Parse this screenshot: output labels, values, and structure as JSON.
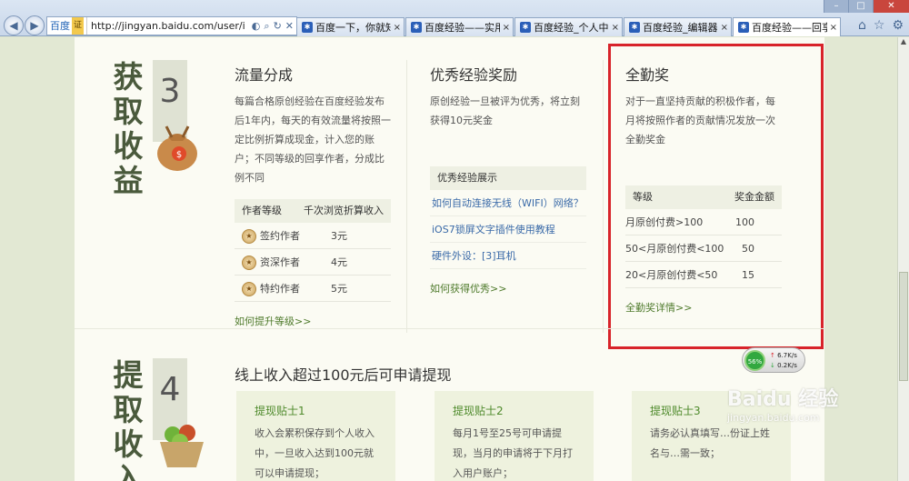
{
  "browser": {
    "address_brand": "百度",
    "address_brand_badge": "证",
    "url": "http://jingyan.baidu.com/user/i",
    "tabs": [
      {
        "label": "百度一下，你就知道",
        "active": false
      },
      {
        "label": "百度经验——实用生活...",
        "active": false
      },
      {
        "label": "百度经验_个人中心_我...",
        "active": false
      },
      {
        "label": "百度经验_编辑器",
        "active": false
      },
      {
        "label": "百度经验——回享计...",
        "active": true
      }
    ]
  },
  "section3": {
    "number": "3",
    "vertical_title": [
      "获",
      "取",
      "收",
      "益"
    ],
    "col1": {
      "title": "流量分成",
      "desc": "每篇合格原创经验在百度经验发布后1年内，每天的有效流量将按照一定比例折算成现金，计入您的账户；不同等级的回享作者，分成比例不同",
      "table_headers": [
        "作者等级",
        "千次浏览折算收入"
      ],
      "rows": [
        {
          "level": "签约作者",
          "income": "3元"
        },
        {
          "level": "资深作者",
          "income": "4元"
        },
        {
          "level": "特约作者",
          "income": "5元"
        }
      ],
      "link": "如何提升等级>>"
    },
    "col2": {
      "title": "优秀经验奖励",
      "desc": "原创经验一旦被评为优秀，将立刻获得10元奖金",
      "showcase_header": "优秀经验展示",
      "items": [
        "如何自动连接无线（WIFI）网络？",
        "iOS7锁屏文字插件使用教程",
        "硬件外设：[3]耳机"
      ],
      "link": "如何获得优秀>>"
    },
    "col3": {
      "title": "全勤奖",
      "desc": "对于一直坚持贡献的积极作者，每月将按照作者的贡献情况发放一次全勤奖金",
      "table_headers": [
        "等级",
        "奖金金额"
      ],
      "rows": [
        {
          "level": "月原创付费>100",
          "amount": "100"
        },
        {
          "level": "50<月原创付费<100",
          "amount": "50"
        },
        {
          "level": "20<月原创付费<50",
          "amount": "15"
        }
      ],
      "link": "全勤奖详情>>"
    }
  },
  "section4": {
    "number": "4",
    "vertical_title": [
      "提",
      "取",
      "收",
      "入"
    ],
    "title": "线上收入超过100元后可申请提现",
    "tips": [
      {
        "title": "提现贴士1",
        "text": "收入会累积保存到个人收入中，一旦收入达到100元就可以申请提现；"
      },
      {
        "title": "提现贴士2",
        "text": "每月1号至25号可申请提现，当月的申请将于下月打入用户账户；"
      },
      {
        "title": "提现贴士3",
        "text": "请务必认真填写…份证上姓名与…需一致；"
      }
    ]
  },
  "speed_widget": {
    "percent": "56%",
    "up": "6.7K/s",
    "down": "0.2K/s"
  },
  "watermark": {
    "main": "Baidu 经验",
    "sub": "jingyan.baidu.com"
  }
}
